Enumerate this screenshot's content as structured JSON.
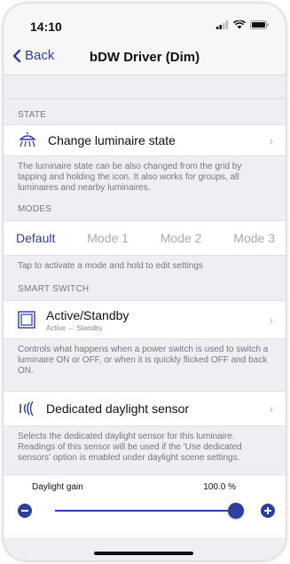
{
  "status_bar": {
    "time": "14:10"
  },
  "nav": {
    "back_label": "Back",
    "title": "bDW Driver (Dim)"
  },
  "state": {
    "header": "STATE",
    "row_label": "Change luminaire state",
    "icon": "luminaire-icon",
    "footer": "The luminaire state can be also changed from the grid by tapping and holding the icon. It also works for groups, all luminaires and nearby luminaires."
  },
  "modes": {
    "header": "MODES",
    "items": [
      "Default",
      "Mode 1",
      "Mode 2",
      "Mode 3"
    ],
    "active": "Default",
    "footer": "Tap to activate a mode and hold to edit settings"
  },
  "smart_switch": {
    "header": "SMART SWITCH",
    "row_label": "Active/Standby",
    "row_sub": "Active ⇔ Standby",
    "icon": "switch-icon",
    "footer": "Controls what happens when a power switch is used to switch a luminaire ON or OFF, or when it is quickly flicked OFF and back ON."
  },
  "daylight": {
    "row_label": "Dedicated daylight sensor",
    "icon": "daylight-sensor-icon",
    "footer": "Selects the dedicated daylight sensor for this luminaire. Readings of this sensor will be used if the 'Use dedicated sensors' option is enabled under daylight scene settings."
  },
  "gain": {
    "label": "Daylight gain",
    "value_text": "100.0 %",
    "level": 1.0
  },
  "colors": {
    "accent": "#2c3e9e"
  }
}
